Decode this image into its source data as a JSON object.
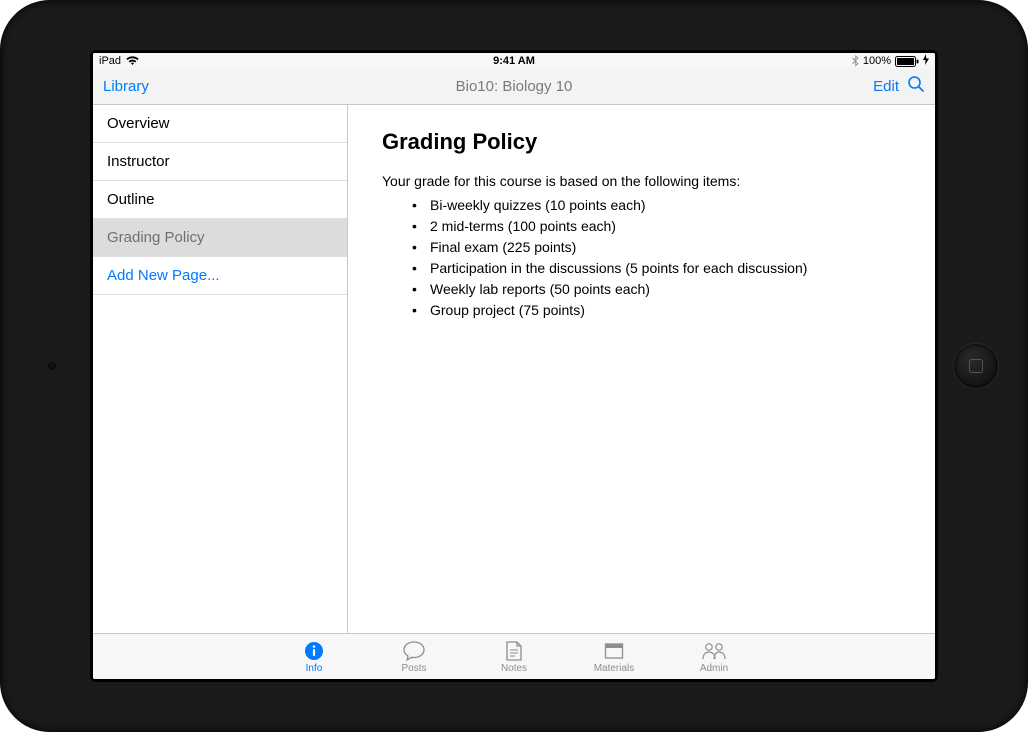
{
  "status": {
    "device": "iPad",
    "time": "9:41 AM",
    "battery_pct": "100%"
  },
  "nav": {
    "back": "Library",
    "title": "Bio10: Biology 10",
    "edit": "Edit"
  },
  "sidebar": {
    "items": [
      {
        "label": "Overview"
      },
      {
        "label": "Instructor"
      },
      {
        "label": "Outline"
      },
      {
        "label": "Grading Policy",
        "selected": true
      }
    ],
    "add_label": "Add New Page..."
  },
  "content": {
    "heading": "Grading Policy",
    "intro": "Your grade for this course is based on the following items:",
    "bullets": [
      "Bi-weekly quizzes (10 points each)",
      "2 mid-terms (100 points each)",
      "Final exam (225 points)",
      "Participation in the discussions (5 points for each discussion)",
      "Weekly lab reports (50 points each)",
      "Group project (75 points)"
    ]
  },
  "tabs": [
    {
      "id": "info",
      "label": "Info",
      "active": true
    },
    {
      "id": "posts",
      "label": "Posts"
    },
    {
      "id": "notes",
      "label": "Notes"
    },
    {
      "id": "materials",
      "label": "Materials"
    },
    {
      "id": "admin",
      "label": "Admin"
    }
  ]
}
